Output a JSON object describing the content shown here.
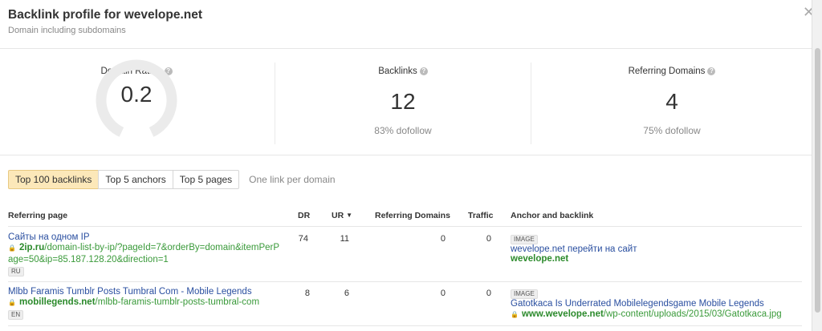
{
  "header": {
    "title": "Backlink profile for wevelope.net",
    "subtitle": "Domain including subdomains"
  },
  "stats": {
    "domain_rating": {
      "label": "Domain Rating",
      "value": "0.2",
      "gauge_fraction": 0.002
    },
    "backlinks": {
      "label": "Backlinks",
      "value": "12",
      "sub": "83% dofollow"
    },
    "referring_domains": {
      "label": "Referring Domains",
      "value": "4",
      "sub": "75% dofollow"
    }
  },
  "tabs": [
    "Top 100 backlinks",
    "Top 5 anchors",
    "Top 5 pages"
  ],
  "tab_link": "One link per domain",
  "table": {
    "headers": {
      "referring_page": "Referring page",
      "dr": "DR",
      "ur": "UR",
      "referring_domains": "Referring Domains",
      "traffic": "Traffic",
      "anchor": "Anchor and backlink"
    },
    "rows": [
      {
        "title": "Сайты на одном IP",
        "url_domain": "2ip.ru",
        "url_path_1": "/domain-list-by-ip/?pageId=7&orderBy=domain&itemPerP",
        "url_path_2": "age=50&ip=85.187.128.20&direction=1",
        "lang": "RU",
        "dr": "74",
        "ur": "11",
        "referring_domains": "0",
        "traffic": "0",
        "anchor_badge": "IMAGE",
        "anchor_text": "wevelope.net перейти на сайт",
        "backlink_domain": "wevelope.net",
        "backlink_path": ""
      },
      {
        "title": "Mlbb Faramis Tumblr Posts Tumbral Com - Mobile Legends",
        "url_domain": "mobillegends.net",
        "url_path_1": "/mlbb-faramis-tumblr-posts-tumbral-com",
        "url_path_2": "",
        "lang": "EN",
        "dr": "8",
        "ur": "6",
        "referring_domains": "0",
        "traffic": "0",
        "anchor_badge": "IMAGE",
        "anchor_text": "Gatotkaca Is Underrated Mobilelegendsgame Mobile Legends",
        "backlink_domain": "www.wevelope.net",
        "backlink_path": "/wp-content/uploads/2015/03/Gatotkaca.jpg"
      }
    ]
  },
  "icons": {
    "close": "close-icon",
    "help": "help-icon",
    "lock": "lock-icon",
    "sort": "sort-desc-icon"
  },
  "colors": {
    "active_tab_bg": "#fce8b9",
    "link_blue": "#2a4fa0",
    "url_green": "#3a9a3a",
    "gauge_track": "#ebebeb"
  }
}
